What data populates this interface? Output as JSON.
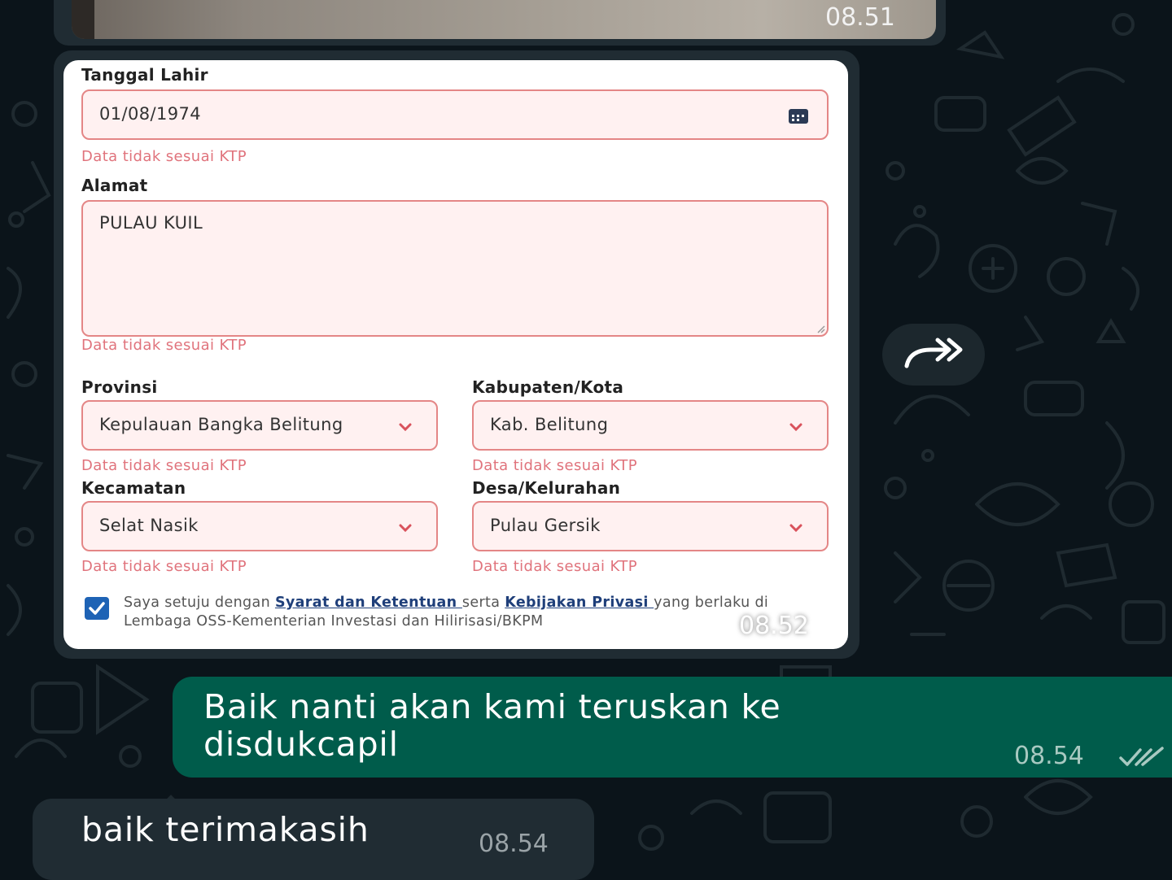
{
  "top_message": {
    "timestamp": "08.51"
  },
  "form_message": {
    "timestamp": "08.52",
    "fields": {
      "birth_date": {
        "label": "Tanggal Lahir",
        "value": "01/08/1974",
        "error": "Data tidak sesuai KTP"
      },
      "address": {
        "label": "Alamat",
        "value": "PULAU KUIL",
        "error": "Data tidak sesuai KTP"
      },
      "province": {
        "label": "Provinsi",
        "value": "Kepulauan Bangka Belitung",
        "error": "Data tidak sesuai KTP"
      },
      "regency": {
        "label": "Kabupaten/Kota",
        "value": "Kab. Belitung",
        "error": "Data tidak sesuai KTP"
      },
      "district": {
        "label": "Kecamatan",
        "value": "Selat Nasik",
        "error": "Data tidak sesuai KTP"
      },
      "village": {
        "label": "Desa/Kelurahan",
        "value": "Pulau Gersik",
        "error": "Data tidak sesuai KTP"
      }
    },
    "consent": {
      "checked": true,
      "prefix": "Saya setuju dengan ",
      "terms_link": "Syarat dan Ketentuan ",
      "middle": "serta ",
      "privacy_link": "Kebijakan Privasi ",
      "suffix": "yang berlaku di Lembaga OSS-Kementerian Investasi dan Hilirisasi/BKPM"
    }
  },
  "outgoing_message": {
    "text": "Baik nanti akan kami teruskan ke disdukcapil",
    "timestamp": "08.54",
    "status_icon": "double-check-icon"
  },
  "incoming_message": {
    "text": "baik terimakasih",
    "timestamp": "08.54"
  },
  "colors": {
    "chat_background": "#0b141a",
    "incoming_bubble": "#202c33",
    "outgoing_bubble": "#005c4b",
    "field_error_border": "#e48686",
    "field_error_fill": "#fff1f1",
    "error_text": "#e0737c",
    "checkbox": "#1e63b5"
  },
  "icons": {
    "calendar": "calendar-icon",
    "dropdown": "chevron-down-icon",
    "forward": "forward-icon"
  }
}
